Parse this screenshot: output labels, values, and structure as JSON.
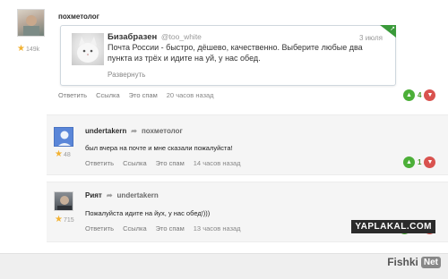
{
  "comments": [
    {
      "username": "похметолог",
      "rating": "149k",
      "tweet": {
        "name": "Бизабразен",
        "handle": "@too_white",
        "date": "3 июля",
        "text": "Почта России - быстро, дёшево, качественно. Выберите любые два пункта из трёх и идите на  уй, у нас обед.",
        "expand": "Развернуть"
      },
      "actions": {
        "reply": "Ответить",
        "link": "Ссылка",
        "spam": "Это спам",
        "time": "20 часов назад"
      },
      "votes": "4"
    },
    {
      "username": "undertakern",
      "reply_to": "похметолог",
      "rating": "48",
      "text": "был вчера на почте и мне сказали пожалуйста!",
      "actions": {
        "reply": "Ответить",
        "link": "Ссылка",
        "spam": "Это спам",
        "time": "14 часов назад"
      },
      "votes": "1"
    },
    {
      "username": "Рият",
      "reply_to": "undertakern",
      "rating": "715",
      "text": "Пожалуйста идите на йух, у нас обед!)))",
      "actions": {
        "reply": "Ответить",
        "link": "Ссылка",
        "spam": "Это спам",
        "time": "13 часов назад"
      },
      "votes": "10"
    }
  ],
  "watermarks": {
    "yaplakal": "YAPLAKAL.COM",
    "fishki": "Fishki",
    "fishki_box": "Net"
  },
  "icons": {
    "star": "star-icon",
    "reply": "reply-arrow-icon",
    "vote_up": "thumbs-up-icon",
    "vote_down": "thumbs-down-icon",
    "twitter": "twitter-corner-icon"
  },
  "colors": {
    "vote_up": "#4caf38",
    "vote_down": "#d9534f",
    "star": "#f2b233",
    "panel": "#f5f5f5"
  }
}
